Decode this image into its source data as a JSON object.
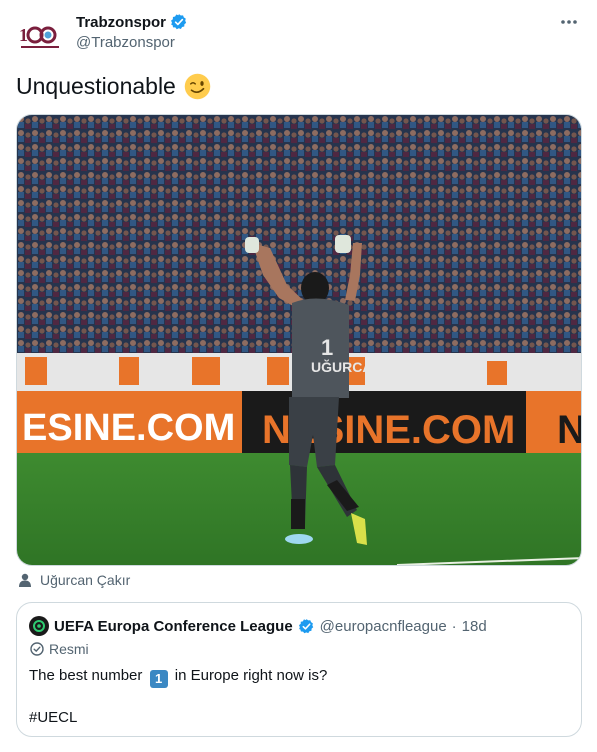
{
  "tweet": {
    "display_name": "Trabzonspor",
    "handle": "@Trabzonspor",
    "text": "Unquestionable",
    "emoji": "winking-face",
    "tagged_user": "Uğurcan Çakır",
    "verified": true
  },
  "media": {
    "banner_left": "ESINE.COM",
    "banner_mid": "NESINE.COM",
    "banner_right": "N",
    "player_number": "1",
    "player_name": "UĞURCAN"
  },
  "quote": {
    "name": "UEFA Europa Conference League",
    "handle": "@europacnfleague",
    "separator": "·",
    "time": "18d",
    "label": "Resmi",
    "text_before": "The best number",
    "number_emoji": "1",
    "text_after": "in Europe right now is?",
    "hashtag": "#UECL"
  },
  "colors": {
    "verified": "#1d9bf0",
    "secondary_text": "#536471",
    "banner_orange": "#e8742a",
    "pitch": "#3d8a2e"
  },
  "icons": [
    "verified-badge-icon",
    "more-icon",
    "person-icon",
    "official-check-icon"
  ]
}
